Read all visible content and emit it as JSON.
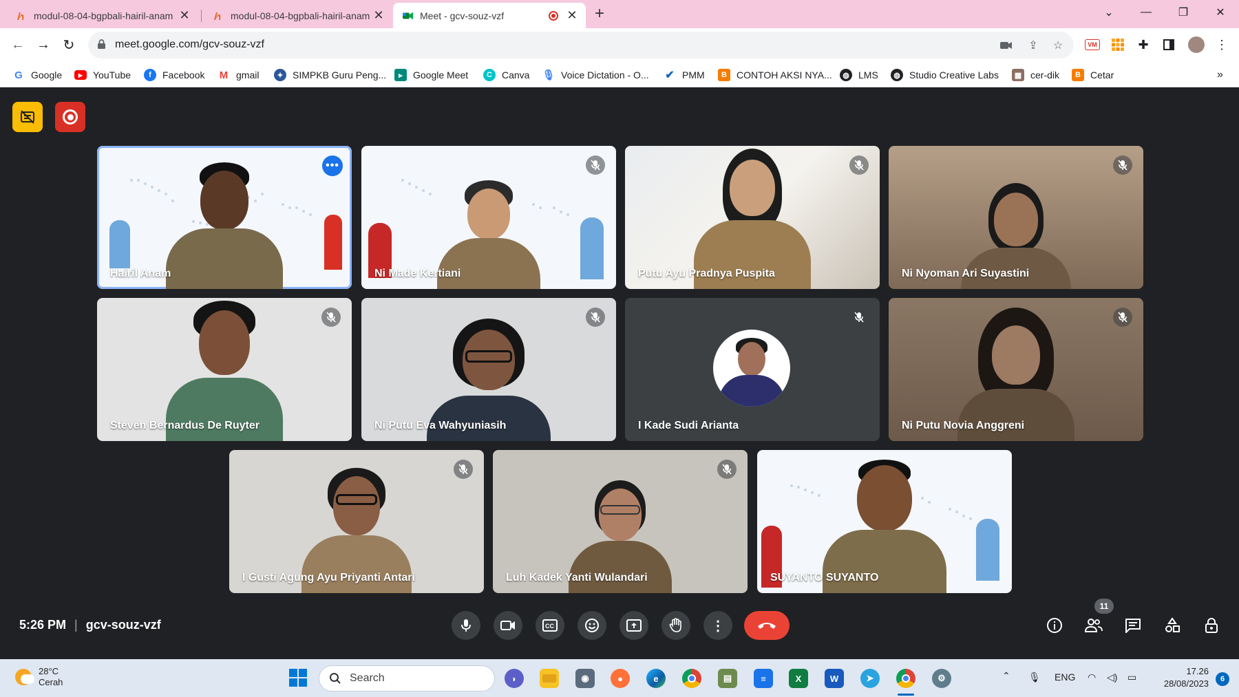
{
  "browser": {
    "tabs": [
      {
        "title": "modul-08-04-bgpbali-hairil-anam",
        "active": false
      },
      {
        "title": "modul-08-04-bgpbali-hairil-anam",
        "active": false
      },
      {
        "title": "Meet - gcv-souz-vzf",
        "active": true
      }
    ],
    "url": "meet.google.com/gcv-souz-vzf",
    "bookmarks": [
      {
        "label": "Google",
        "icon": "google-icon",
        "color": "#4285f4"
      },
      {
        "label": "YouTube",
        "icon": "youtube-icon",
        "color": "#ff0000"
      },
      {
        "label": "Facebook",
        "icon": "facebook-icon",
        "color": "#1877f2"
      },
      {
        "label": "gmail",
        "icon": "gmail-icon",
        "color": "#ea4335"
      },
      {
        "label": "SIMPKB Guru Peng...",
        "icon": "simpkb-icon",
        "color": "#2b579a"
      },
      {
        "label": "Google Meet",
        "icon": "google-meet-icon",
        "color": "#00897b"
      },
      {
        "label": "Canva",
        "icon": "canva-icon",
        "color": "#00c4cc"
      },
      {
        "label": "Voice Dictation - O...",
        "icon": "microphone-icon",
        "color": "#4285f4"
      },
      {
        "label": "PMM",
        "icon": "pmm-icon",
        "color": "#1565c0"
      },
      {
        "label": "CONTOH AKSI NYA...",
        "icon": "blogger-icon",
        "color": "#f57c00"
      },
      {
        "label": "LMS",
        "icon": "globe-icon",
        "color": "#202124"
      },
      {
        "label": "Studio Creative Labs",
        "icon": "globe-icon",
        "color": "#202124"
      },
      {
        "label": "cer-dik",
        "icon": "cerdik-icon",
        "color": "#8d6e63"
      },
      {
        "label": "Cetar",
        "icon": "blogger-icon",
        "color": "#f57c00"
      }
    ]
  },
  "meet": {
    "participants": [
      {
        "name": "Hairil Anam",
        "muted": false,
        "active": true,
        "bg": "banner"
      },
      {
        "name": "Ni Made Kertiani",
        "muted": true,
        "active": false,
        "bg": "banner"
      },
      {
        "name": "Putu Ayu Pradnya Puspita",
        "muted": true,
        "active": false,
        "bg": "room"
      },
      {
        "name": "Ni Nyoman Ari Suyastini",
        "muted": true,
        "active": false,
        "bg": "room-dark"
      },
      {
        "name": "Steven Bernardus De Ruyter",
        "muted": true,
        "active": false,
        "bg": "wall"
      },
      {
        "name": "Ni Putu Eva Wahyuniasih",
        "muted": true,
        "active": false,
        "bg": "wall"
      },
      {
        "name": "I Kade Sudi Arianta",
        "muted": true,
        "active": false,
        "bg": "avatar"
      },
      {
        "name": "Ni Putu Novia Anggreni",
        "muted": true,
        "active": false,
        "bg": "room-dark"
      },
      {
        "name": "I Gusti Agung Ayu Priyanti Antari",
        "muted": true,
        "active": false,
        "bg": "wall"
      },
      {
        "name": "Luh Kadek Yanti Wulandari",
        "muted": true,
        "active": false,
        "bg": "wall"
      },
      {
        "name": "SUYANTO SUYANTO",
        "muted": false,
        "active": false,
        "bg": "banner"
      }
    ],
    "time": "5:26 PM",
    "meeting_code": "gcv-souz-vzf",
    "participant_count": "11",
    "colors": {
      "accent": "#8ab4f8",
      "end_call": "#ea4335",
      "control": "#3c4043"
    }
  },
  "taskbar": {
    "weather_temp": "28°C",
    "weather_desc": "Cerah",
    "search_placeholder": "Search",
    "language": "ENG",
    "time": "17.26",
    "date": "28/08/2023",
    "notifications": "6"
  }
}
